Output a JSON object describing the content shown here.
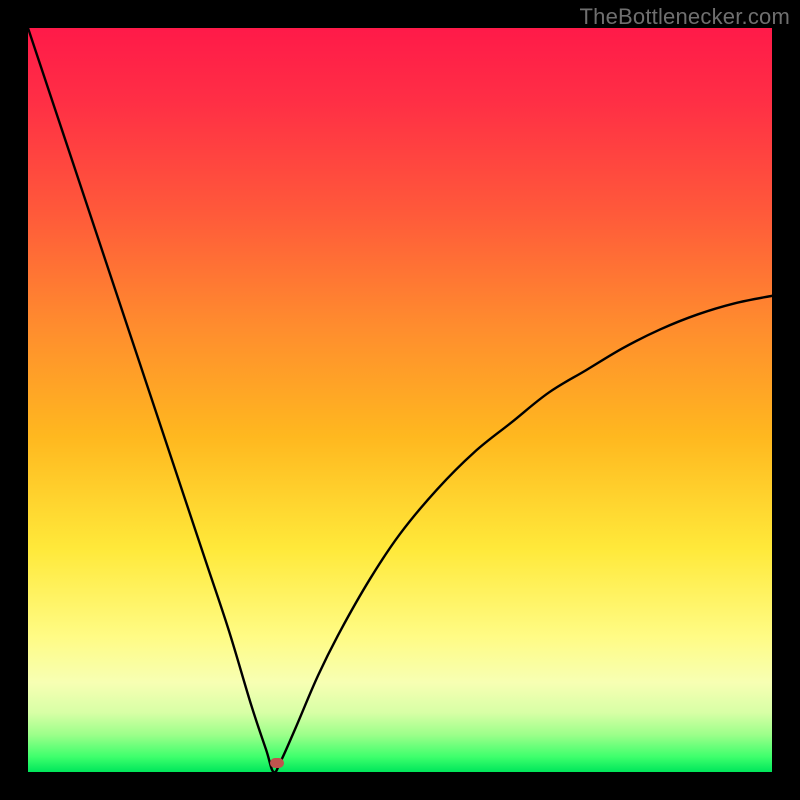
{
  "watermark": "TheBottlenecker.com",
  "colors": {
    "frame": "#000000",
    "gradient_top": "#ff1a49",
    "gradient_bottom": "#00e65b",
    "curve": "#000000",
    "marker": "#c0544e",
    "watermark": "#6f6f6f"
  },
  "chart_data": {
    "type": "line",
    "title": "",
    "xlabel": "",
    "ylabel": "",
    "xlim": [
      0,
      1
    ],
    "ylim": [
      0,
      1
    ],
    "grid": false,
    "legend": false,
    "annotations": [
      "TheBottlenecker.com"
    ],
    "series": [
      {
        "name": "bottleneck-curve",
        "comment": "V-shaped curve; y≈0 at x≈0.33 (minimum). Left branch nearly linear rising to y≈1 at x=0. Right branch concave, rising toward y≈0.64 at x=1.",
        "x": [
          0.0,
          0.03,
          0.06,
          0.09,
          0.12,
          0.15,
          0.18,
          0.21,
          0.24,
          0.27,
          0.3,
          0.32,
          0.33,
          0.34,
          0.36,
          0.39,
          0.42,
          0.46,
          0.5,
          0.55,
          0.6,
          0.65,
          0.7,
          0.75,
          0.8,
          0.85,
          0.9,
          0.95,
          1.0
        ],
        "y": [
          1.0,
          0.91,
          0.82,
          0.73,
          0.64,
          0.55,
          0.46,
          0.37,
          0.28,
          0.19,
          0.09,
          0.03,
          0.0,
          0.015,
          0.06,
          0.13,
          0.19,
          0.26,
          0.32,
          0.38,
          0.43,
          0.47,
          0.51,
          0.54,
          0.57,
          0.595,
          0.615,
          0.63,
          0.64
        ]
      }
    ],
    "marker": {
      "x": 0.335,
      "y": 0.012
    }
  }
}
